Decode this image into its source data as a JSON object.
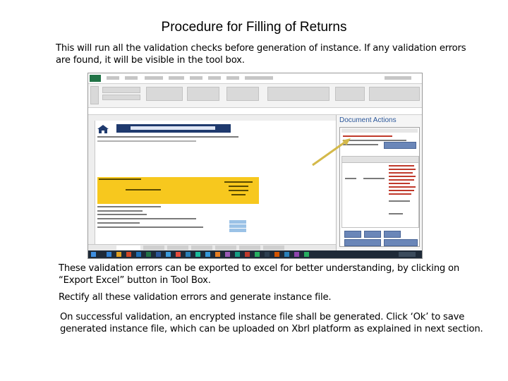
{
  "title": "Procedure for Filling of Returns",
  "paragraphs": {
    "p1": "This will run all the validation checks before generation of instance. If any validation errors are found, it will be visible in the tool box.",
    "p2": "These validation errors can be exported to excel for better understanding, by clicking on “Export Excel” button in Tool Box.",
    "p3": "Rectify all these validation errors and generate instance file.",
    "p4": "On successful validation, an encrypted instance file shall be generated. Click ‘Ok’ to save generated instance file, which can be uploaded on Xbrl platform as explained in next section."
  },
  "screenshot": {
    "pane_title": "Document Actions",
    "arrow_color": "#d4b94a",
    "accent": "#217346"
  }
}
